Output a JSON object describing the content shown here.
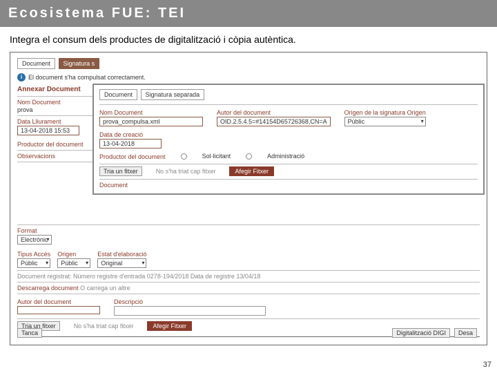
{
  "title": "Ecosistema FUE: TEI",
  "subtitle": "Integra el consum dels productes de digitalització i còpia autèntica.",
  "page_number": "37",
  "tabs": {
    "document": "Document",
    "signatura": "Signatura s"
  },
  "info_msg": "El document s'ha compulsat correctament.",
  "section_annex": "Annexar Document",
  "left": {
    "nom_doc_label": "Nom Document",
    "nom_doc_value": "prova",
    "data_label": "Data Lliurament",
    "data_value": "13-04-2018 15:53",
    "productor_label": "Productor del document",
    "observ_label": "Observacions"
  },
  "overlay": {
    "tab_doc": "Document",
    "tab_sig": "Signatura separada",
    "nom_label": "Nom Document",
    "nom_value": "prova_compulsa.xml",
    "autor_label": "Autor del document",
    "autor_value": "OID.2.5.4.5=#14154D65726368,CN=A",
    "origen_label": "Origen de la signatura Origen",
    "origen_value": "Públic",
    "data_label": "Data de creació",
    "data_value": "13-04-2018",
    "prod_label": "Productor del document",
    "radio_sol": "Sol·licitant",
    "radio_adm": "Administració",
    "tria": "Tria un fitxer",
    "no_triat": "No s'ha triat cap fitxer",
    "afegir": "Afegir Fitxer",
    "doc_label": "Document"
  },
  "mid": {
    "format_label": "Format",
    "format_value": "Electrònic",
    "tipus_label": "Tipus Accés",
    "tipus_value": "Públic",
    "origen_label": "Origen",
    "origen_value": "Públic",
    "estat_label": "Estat d'elaboració",
    "estat_value": "Original",
    "reg_text": "Document registrat: Número registre d'entrada  0278-194/2018 Data de registre  13/04/18",
    "descarrega": "Descarrega document",
    "ocarrega": "O carrega un altre",
    "autor2_label": "Autor del document",
    "desc_label": "Descripció",
    "tria2": "Tria un fitxer",
    "no_triat2": "No s'ha triat cap fitxer",
    "afegir2": "Afegir Fitxer"
  },
  "footer": {
    "tanca": "Tanca",
    "digi": "Digitalització DIGI",
    "desa": "Desa"
  }
}
